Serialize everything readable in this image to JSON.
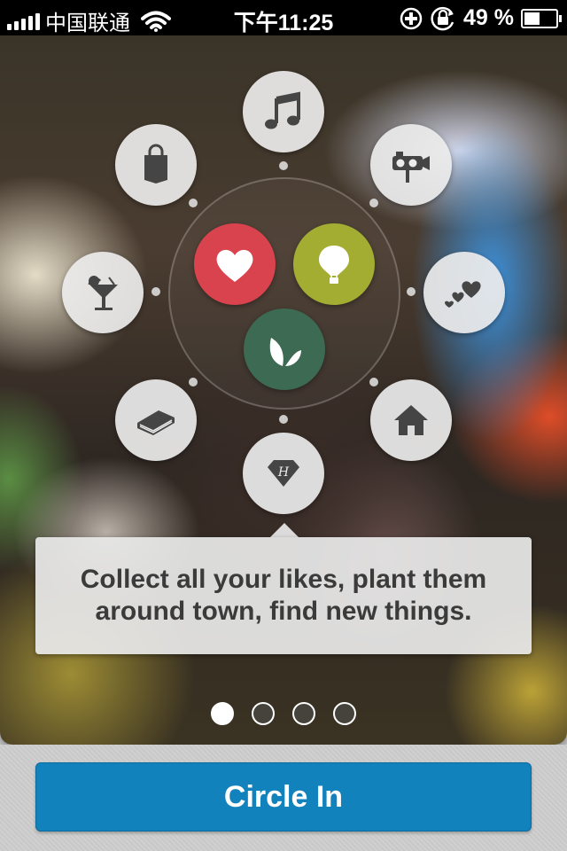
{
  "status_bar": {
    "carrier": "中国联通",
    "time": "下午11:25",
    "battery": "49 %",
    "battery_level": 0.49
  },
  "icons": {
    "outer": [
      "music-note-icon",
      "video-camera-icon",
      "hearts-icon",
      "house-icon",
      "diamond-badge-icon",
      "book-icon",
      "cocktail-icon",
      "shopping-bag-icon"
    ],
    "center": [
      "heart-icon",
      "balloon-icon",
      "leaf-icon"
    ]
  },
  "colors": {
    "heart": "#d9434d",
    "balloon": "#a3ad32",
    "leaf": "#3d6a52",
    "button": "#1282bc"
  },
  "tooltip": {
    "text": "Collect all your likes, plant them around town, find new things."
  },
  "pager": {
    "count": 4,
    "active_index": 0
  },
  "cta": {
    "label": "Circle In"
  }
}
